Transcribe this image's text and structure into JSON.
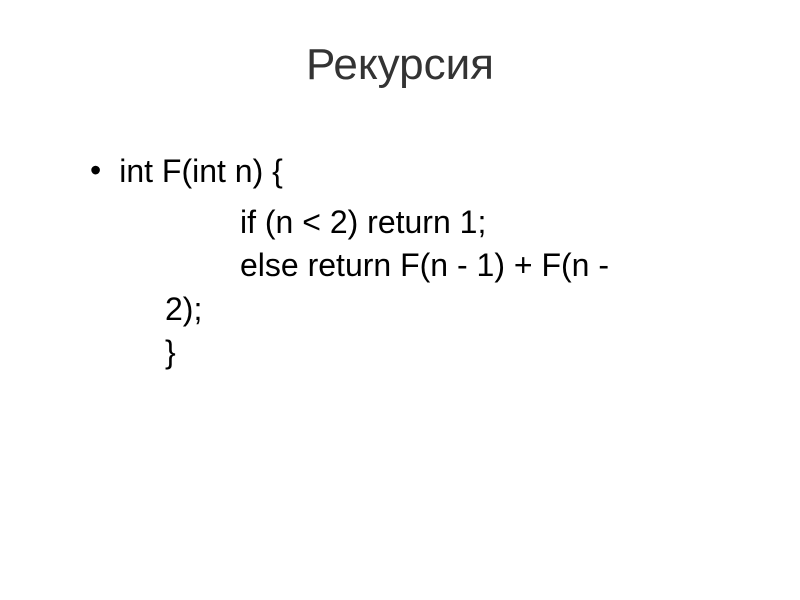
{
  "slide": {
    "title": "Рекурсия",
    "lines": {
      "line1": "int F(int n) {",
      "line2": "if (n < 2) return 1;",
      "line3": "else return F(n - 1) + F(n -",
      "line3b": "2);",
      "line4": "}"
    }
  }
}
